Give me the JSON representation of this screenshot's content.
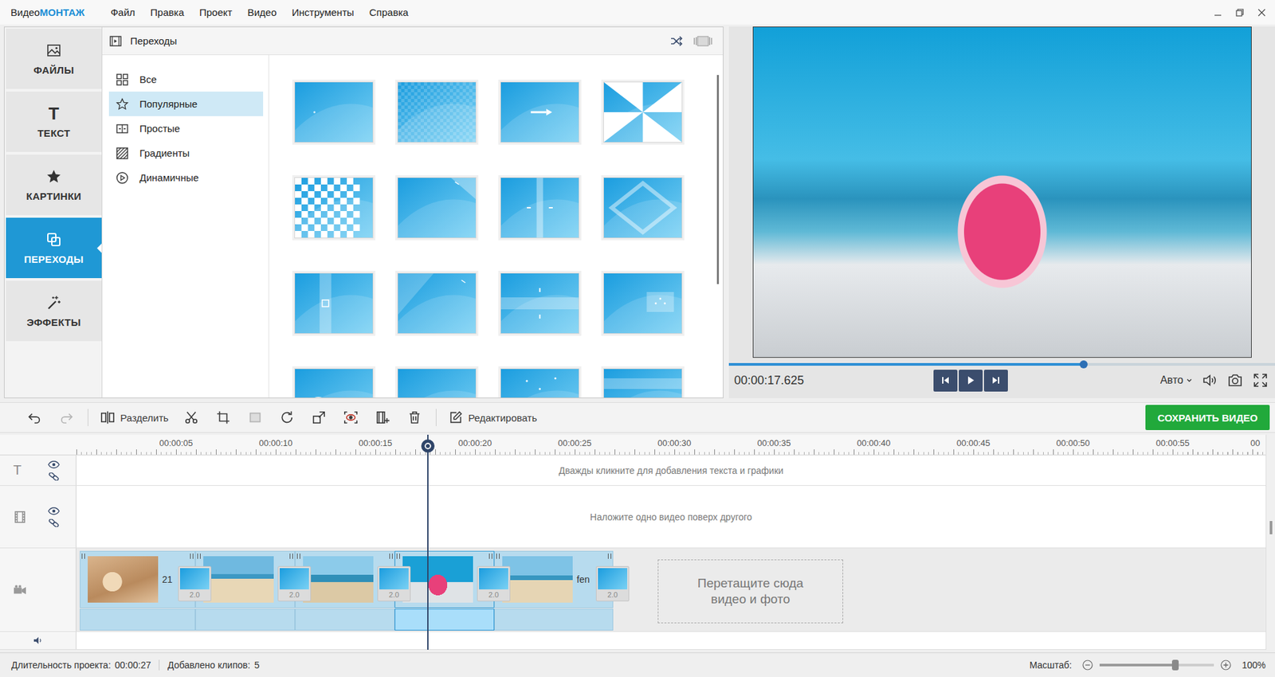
{
  "window": {
    "title": {
      "prefix": "Видео",
      "brand": "МОНТАЖ"
    }
  },
  "menu": [
    "Файл",
    "Правка",
    "Проект",
    "Видео",
    "Инструменты",
    "Справка"
  ],
  "sidebar": {
    "items": [
      {
        "label": "ФАЙЛЫ",
        "kind": "files",
        "glyph": "",
        "selected": false
      },
      {
        "label": "ТЕКСТ",
        "kind": "text",
        "glyph": "T",
        "selected": false
      },
      {
        "label": "КАРТИНКИ",
        "kind": "pictures",
        "glyph": "",
        "selected": false
      },
      {
        "label": "ПЕРЕХОДЫ",
        "kind": "transitions",
        "glyph": "",
        "selected": true
      },
      {
        "label": "ЭФФЕКТЫ",
        "kind": "effects",
        "glyph": "",
        "selected": false
      }
    ]
  },
  "transitions_panel": {
    "title": "Переходы",
    "categories": [
      {
        "label": "Все",
        "kind": "all",
        "selected": false
      },
      {
        "label": "Популярные",
        "kind": "popular",
        "selected": true
      },
      {
        "label": "Простые",
        "kind": "simple",
        "selected": false
      },
      {
        "label": "Градиенты",
        "kind": "gradients",
        "selected": false
      },
      {
        "label": "Динамичные",
        "kind": "dynamic",
        "selected": false
      }
    ],
    "thumbnails": [
      {
        "kind": "fade"
      },
      {
        "kind": "dissolve"
      },
      {
        "kind": "slide"
      },
      {
        "kind": "pinwheel"
      },
      {
        "kind": "mosaic"
      },
      {
        "kind": "page-curl"
      },
      {
        "kind": "split"
      },
      {
        "kind": "diamond"
      },
      {
        "kind": "bar-vertical"
      },
      {
        "kind": "page-turn"
      },
      {
        "kind": "bar-horizontal"
      },
      {
        "kind": "box"
      },
      {
        "kind": "circle"
      },
      {
        "kind": "plain"
      },
      {
        "kind": "sparkle"
      },
      {
        "kind": "band"
      }
    ]
  },
  "preview": {
    "time": "00:00:17.625",
    "progress": 0.65,
    "quality": "Авто"
  },
  "toolbar": {
    "groups": [
      [
        {
          "kind": "undo",
          "label": "",
          "disabled": false
        },
        {
          "kind": "redo",
          "label": "",
          "disabled": true
        }
      ],
      [
        {
          "kind": "split",
          "label": "Разделить",
          "disabled": false
        },
        {
          "kind": "cut",
          "label": "",
          "disabled": false
        },
        {
          "kind": "crop",
          "label": "",
          "disabled": false
        },
        {
          "kind": "frame",
          "label": "",
          "disabled": true
        },
        {
          "kind": "rotate",
          "label": "",
          "disabled": false
        },
        {
          "kind": "resize",
          "label": "",
          "disabled": false
        },
        {
          "kind": "stabilize",
          "label": "",
          "disabled": false
        },
        {
          "kind": "replace",
          "label": "",
          "disabled": false
        },
        {
          "kind": "delete",
          "label": "",
          "disabled": false
        }
      ],
      [
        {
          "kind": "edit",
          "label": "Редактировать",
          "disabled": false
        }
      ]
    ],
    "save": "СОХРАНИТЬ ВИДЕО"
  },
  "timeline": {
    "ticks": [
      "00:00:05",
      "00:00:10",
      "00:00:15",
      "00:00:20",
      "00:00:25",
      "00:00:30",
      "00:00:35",
      "00:00:40",
      "00:00:45",
      "00:00:50",
      "00:00:55",
      "00"
    ],
    "text_track": {
      "glyph": "T",
      "hint": "Дважды кликните для добавления текста и графики"
    },
    "overlay_track": {
      "hint": "Наложите одно видео поверх другого"
    },
    "video_track": {
      "clips": [
        {
          "name": "21",
          "selected": false,
          "transition": "2.0"
        },
        {
          "name": "",
          "selected": false,
          "transition": "2.0"
        },
        {
          "name": "",
          "selected": false,
          "transition": "2.0"
        },
        {
          "name": "",
          "selected": true,
          "transition": "2.0"
        },
        {
          "name": "fen",
          "selected": false,
          "transition": "2.0"
        }
      ],
      "drop_zone": "Перетащите сюда видео и фото"
    }
  },
  "status_bar": {
    "items": [
      {
        "label": "Длительность проекта:",
        "value": "00:00:27"
      },
      {
        "label": "Добавлено клипов:",
        "value": "5"
      }
    ],
    "zoom": {
      "label": "Масштаб:",
      "level": 0.66,
      "value": "100%"
    }
  }
}
